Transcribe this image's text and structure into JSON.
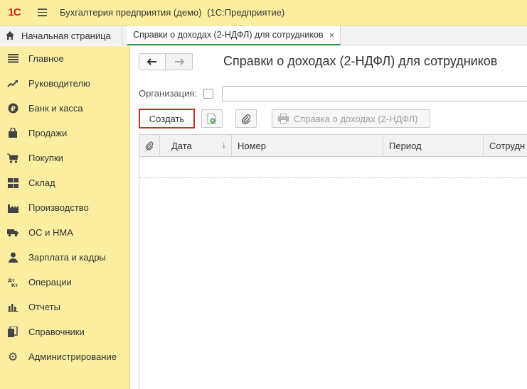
{
  "titlebar": {
    "logo_text": "1С",
    "title": "Бухгалтерия предприятия (демо)",
    "subtitle": "(1С:Предприятие)"
  },
  "tabs": {
    "home_label": "Начальная страница",
    "active_label": "Справки о доходах (2-НДФЛ) для сотрудников",
    "close_glyph": "×"
  },
  "sidebar": {
    "items": [
      {
        "label": "Главное",
        "icon": "menu-lines-icon"
      },
      {
        "label": "Руководителю",
        "icon": "trend-icon"
      },
      {
        "label": "Банк и касса",
        "icon": "ruble-icon"
      },
      {
        "label": "Продажи",
        "icon": "bag-icon"
      },
      {
        "label": "Покупки",
        "icon": "cart-icon"
      },
      {
        "label": "Склад",
        "icon": "warehouse-icon"
      },
      {
        "label": "Производство",
        "icon": "factory-icon"
      },
      {
        "label": "ОС и НМА",
        "icon": "truck-icon"
      },
      {
        "label": "Зарплата и кадры",
        "icon": "person-icon"
      },
      {
        "label": "Операции",
        "icon": "dt-kt-icon"
      },
      {
        "label": "Отчеты",
        "icon": "bar-chart-icon"
      },
      {
        "label": "Справочники",
        "icon": "books-icon"
      },
      {
        "label": "Администрирование",
        "icon": "gear-icon"
      }
    ]
  },
  "main": {
    "title": "Справки о доходах (2-НДФЛ) для сотрудников",
    "back_glyph": "🡐",
    "forward_glyph": "🡒",
    "organization_label": "Организация:",
    "organization_value": "",
    "create_label": "Создать",
    "report_label": "Справка о доходах (2-НДФЛ)",
    "highlight_color": "#d12d2d"
  },
  "table": {
    "columns": [
      "Дата",
      "Номер",
      "Период",
      "Сотрудн"
    ],
    "sort_glyph": "↓",
    "rows": []
  }
}
